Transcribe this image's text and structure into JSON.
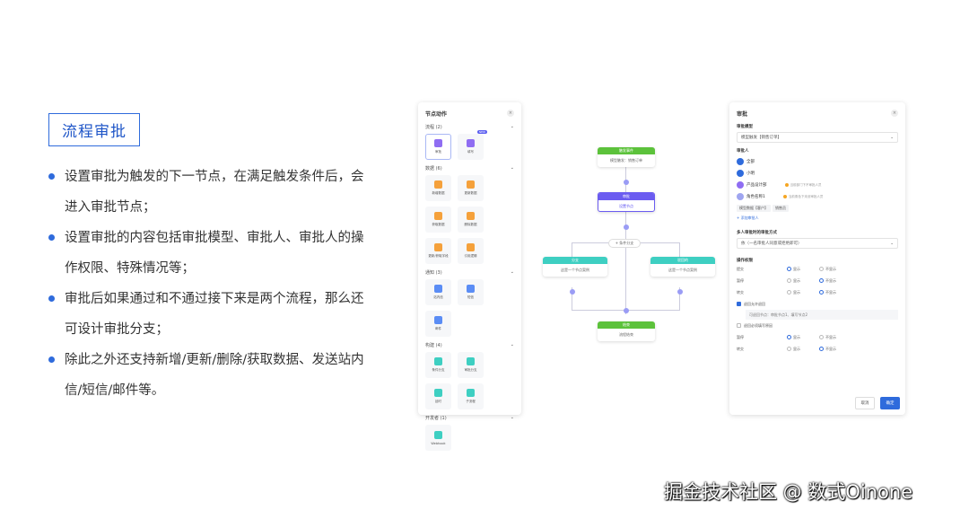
{
  "slide": {
    "title": "流程审批",
    "bullets": [
      "设置审批为触发的下一节点，在满足触发条件后，会进入审批节点；",
      "设置审批的内容包括审批模型、审批人、审批人的操作权限、特殊情况等；",
      "审批后如果通过和不通过接下来是两个流程，那么还可设计审批分支；",
      "除此之外还支持新增/更新/删除/获取数据、发送站内信/短信/邮件等。"
    ]
  },
  "node_panel": {
    "title": "节点动作",
    "close": "×",
    "sections": [
      {
        "label": "流程 (2)",
        "tiles": [
          {
            "label": "审批",
            "color": "#8f6df2"
          },
          {
            "label": "填写",
            "color": "#8f6df2",
            "badge": "NEW"
          }
        ]
      },
      {
        "label": "数据 (6)",
        "tiles": [
          {
            "label": "新增数据",
            "color": "#f5a13b"
          },
          {
            "label": "更新数据",
            "color": "#f5a13b"
          },
          {
            "label": "获取数据",
            "color": "#f5a13b"
          },
          {
            "label": "删除数据",
            "color": "#f5a13b"
          },
          {
            "label": "更新/获取字段",
            "color": "#f5a13b"
          },
          {
            "label": "引用逻辑",
            "color": "#f5a13b"
          }
        ]
      },
      {
        "label": "通知 (3)",
        "tiles": [
          {
            "label": "站内信",
            "color": "#5b8df5"
          },
          {
            "label": "短信",
            "color": "#5b8df5"
          },
          {
            "label": "邮件",
            "color": "#5b8df5"
          }
        ]
      },
      {
        "label": "构建 (4)",
        "tiles": [
          {
            "label": "条件分支",
            "color": "#3ecfc2"
          },
          {
            "label": "审批分支",
            "color": "#3ecfc2"
          },
          {
            "label": "延时",
            "color": "#3ecfc2"
          },
          {
            "label": "子流程",
            "color": "#3ecfc2"
          }
        ]
      },
      {
        "label": "开发者 (1)",
        "tiles": [
          {
            "label": "Webhook",
            "color": "#3ecfc2"
          }
        ]
      }
    ]
  },
  "flow": {
    "trigger": {
      "header": "触发事件",
      "body": "模型触发：销售订单"
    },
    "approve": {
      "header": "审批",
      "body": "设置节点"
    },
    "branch_tag": "+ 条件分支",
    "left": {
      "header": "分支",
      "body": "这是一个节点案例"
    },
    "right": {
      "header": "驳回的",
      "body": "这是一个节点案例"
    },
    "end": {
      "header": "结束",
      "body": "流程结束"
    }
  },
  "approve_panel": {
    "title": "审批",
    "close": "×",
    "model_label": "审批模型",
    "model_value": "模型触发【销售订单】",
    "approvers_label": "审批人",
    "approvers": [
      {
        "name": "全部",
        "tag": "",
        "hint": "",
        "color": "#2f6bdc"
      },
      {
        "name": "小明",
        "tag": "",
        "hint": "",
        "color": "#2f6bdc"
      },
      {
        "name": "产品设计部",
        "tag": "",
        "hint": "当前部门下不审批人员",
        "color": "#8f6df2"
      },
      {
        "name": "角色名称1",
        "tag": "",
        "hint": "当前角色下未设审批人员",
        "color": "#9fa5f0"
      }
    ],
    "model_field": "模型数据【客户】",
    "model_field_tag": "销售员",
    "add_link": "+ 添加审批人",
    "multi_label": "多人审批时的审批方式",
    "multi_value": "依（一名审批人同意或拒绝即可）",
    "ops_label": "操作权限",
    "ops": [
      {
        "name": "提交",
        "show": "显示",
        "hide": "不显示",
        "on": "show"
      },
      {
        "name": "暂停",
        "show": "显示",
        "hide": "不显示",
        "on": "hide"
      },
      {
        "name": "转交",
        "show": "显示",
        "hide": "不显示",
        "on": "hide"
      }
    ],
    "check1": "退回允许退回",
    "return_text": "可退回节点：审批节点1、填写节点2",
    "check2": "退回必须填写原因",
    "ops2": [
      {
        "name": "暂停",
        "show": "显示",
        "hide": "不显示",
        "on": "show"
      },
      {
        "name": "转交",
        "show": "显示",
        "hide": "不显示",
        "on": "hide"
      }
    ],
    "cancel": "取消",
    "ok": "确定"
  },
  "watermark": "掘金技术社区 @ 数式Oinone"
}
